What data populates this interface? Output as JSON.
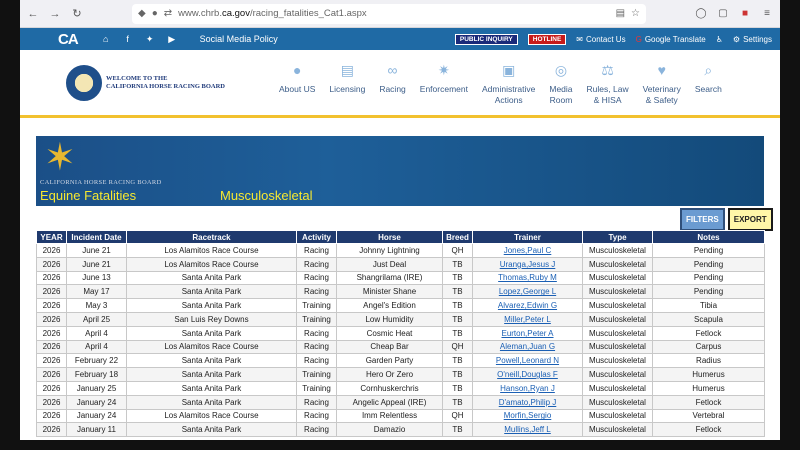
{
  "browser": {
    "url_prefix": "www.chrb.",
    "url_domain": "ca.gov",
    "url_path": "/racing_fatalities_Cat1.aspx"
  },
  "topbar": {
    "logo": "CA",
    "social_media_policy": "Social Media Policy",
    "public_inquiry": "PUBLIC INQUIRY",
    "hotline": "HOTLINE",
    "contact_us": "Contact Us",
    "google_translate": "Google Translate",
    "settings": "Settings"
  },
  "header": {
    "logo_line1": "WELCOME TO THE",
    "logo_line2": "CALIFORNIA HORSE RACING BOARD",
    "nav": [
      {
        "label_1": "About US",
        "label_2": "",
        "icon": "chat-icon"
      },
      {
        "label_1": "Licensing",
        "label_2": "",
        "icon": "license-icon"
      },
      {
        "label_1": "Racing",
        "label_2": "",
        "icon": "binoculars-icon"
      },
      {
        "label_1": "Enforcement",
        "label_2": "",
        "icon": "badge-icon"
      },
      {
        "label_1": "Administrative",
        "label_2": "Actions",
        "icon": "briefcase-icon"
      },
      {
        "label_1": "Media",
        "label_2": "Room",
        "icon": "globe-icon"
      },
      {
        "label_1": "Rules, Law",
        "label_2": "& HISA",
        "icon": "scales-icon"
      },
      {
        "label_1": "Veterinary",
        "label_2": "& Safety",
        "icon": "heart-icon"
      },
      {
        "label_1": "Search",
        "label_2": "",
        "icon": "search-icon"
      }
    ]
  },
  "banner": {
    "subtitle": "CALIFORNIA HORSE RACING BOARD",
    "title": "Equine Fatalities",
    "category": "Musculoskeletal"
  },
  "actions": {
    "filters": "FILTERS",
    "export": "EXPORT"
  },
  "table": {
    "headers": [
      "YEAR",
      "Incident Date",
      "Racetrack",
      "Activity",
      "Horse",
      "Breed",
      "Trainer",
      "Type",
      "Notes"
    ],
    "rows": [
      [
        "2026",
        "June 21",
        "Los Alamitos Race Course",
        "Racing",
        "Johnny Lightning",
        "QH",
        "Jones,Paul C",
        "Musculoskeletal",
        "Pending"
      ],
      [
        "2026",
        "June 21",
        "Los Alamitos Race Course",
        "Racing",
        "Just Deal",
        "TB",
        "Uranga,Jesus J",
        "Musculoskeletal",
        "Pending"
      ],
      [
        "2026",
        "June 13",
        "Santa Anita Park",
        "Racing",
        "Shangrilama (IRE)",
        "TB",
        "Thomas,Ruby M",
        "Musculoskeletal",
        "Pending"
      ],
      [
        "2026",
        "May 17",
        "Santa Anita Park",
        "Racing",
        "Minister Shane",
        "TB",
        "Lopez,George L",
        "Musculoskeletal",
        "Pending"
      ],
      [
        "2026",
        "May 3",
        "Santa Anita Park",
        "Training",
        "Angel's Edition",
        "TB",
        "Alvarez,Edwin G",
        "Musculoskeletal",
        "Tibia"
      ],
      [
        "2026",
        "April 25",
        "San Luis Rey Downs",
        "Training",
        "Low Humidity",
        "TB",
        "Miller,Peter L",
        "Musculoskeletal",
        "Scapula"
      ],
      [
        "2026",
        "April 4",
        "Santa Anita Park",
        "Racing",
        "Cosmic Heat",
        "TB",
        "Eurton,Peter A",
        "Musculoskeletal",
        "Fetlock"
      ],
      [
        "2026",
        "April 4",
        "Los Alamitos Race Course",
        "Racing",
        "Cheap Bar",
        "QH",
        "Aleman,Juan G",
        "Musculoskeletal",
        "Carpus"
      ],
      [
        "2026",
        "February 22",
        "Santa Anita Park",
        "Racing",
        "Garden Party",
        "TB",
        "Powell,Leonard N",
        "Musculoskeletal",
        "Radius"
      ],
      [
        "2026",
        "February 18",
        "Santa Anita Park",
        "Training",
        "Hero Or Zero",
        "TB",
        "O'neill,Douglas F",
        "Musculoskeletal",
        "Humerus"
      ],
      [
        "2026",
        "January 25",
        "Santa Anita Park",
        "Training",
        "Cornhuskerchris",
        "TB",
        "Hanson,Ryan J",
        "Musculoskeletal",
        "Humerus"
      ],
      [
        "2026",
        "January 24",
        "Santa Anita Park",
        "Racing",
        "Angelic Appeal (IRE)",
        "TB",
        "D'amato,Philip J",
        "Musculoskeletal",
        "Fetlock"
      ],
      [
        "2026",
        "January 24",
        "Los Alamitos Race Course",
        "Racing",
        "Imm Relentless",
        "QH",
        "Morfin,Sergio",
        "Musculoskeletal",
        "Vertebral"
      ],
      [
        "2026",
        "January 11",
        "Santa Anita Park",
        "Racing",
        "Damazio",
        "TB",
        "Mullins,Jeff L",
        "Musculoskeletal",
        "Fetlock"
      ]
    ]
  }
}
